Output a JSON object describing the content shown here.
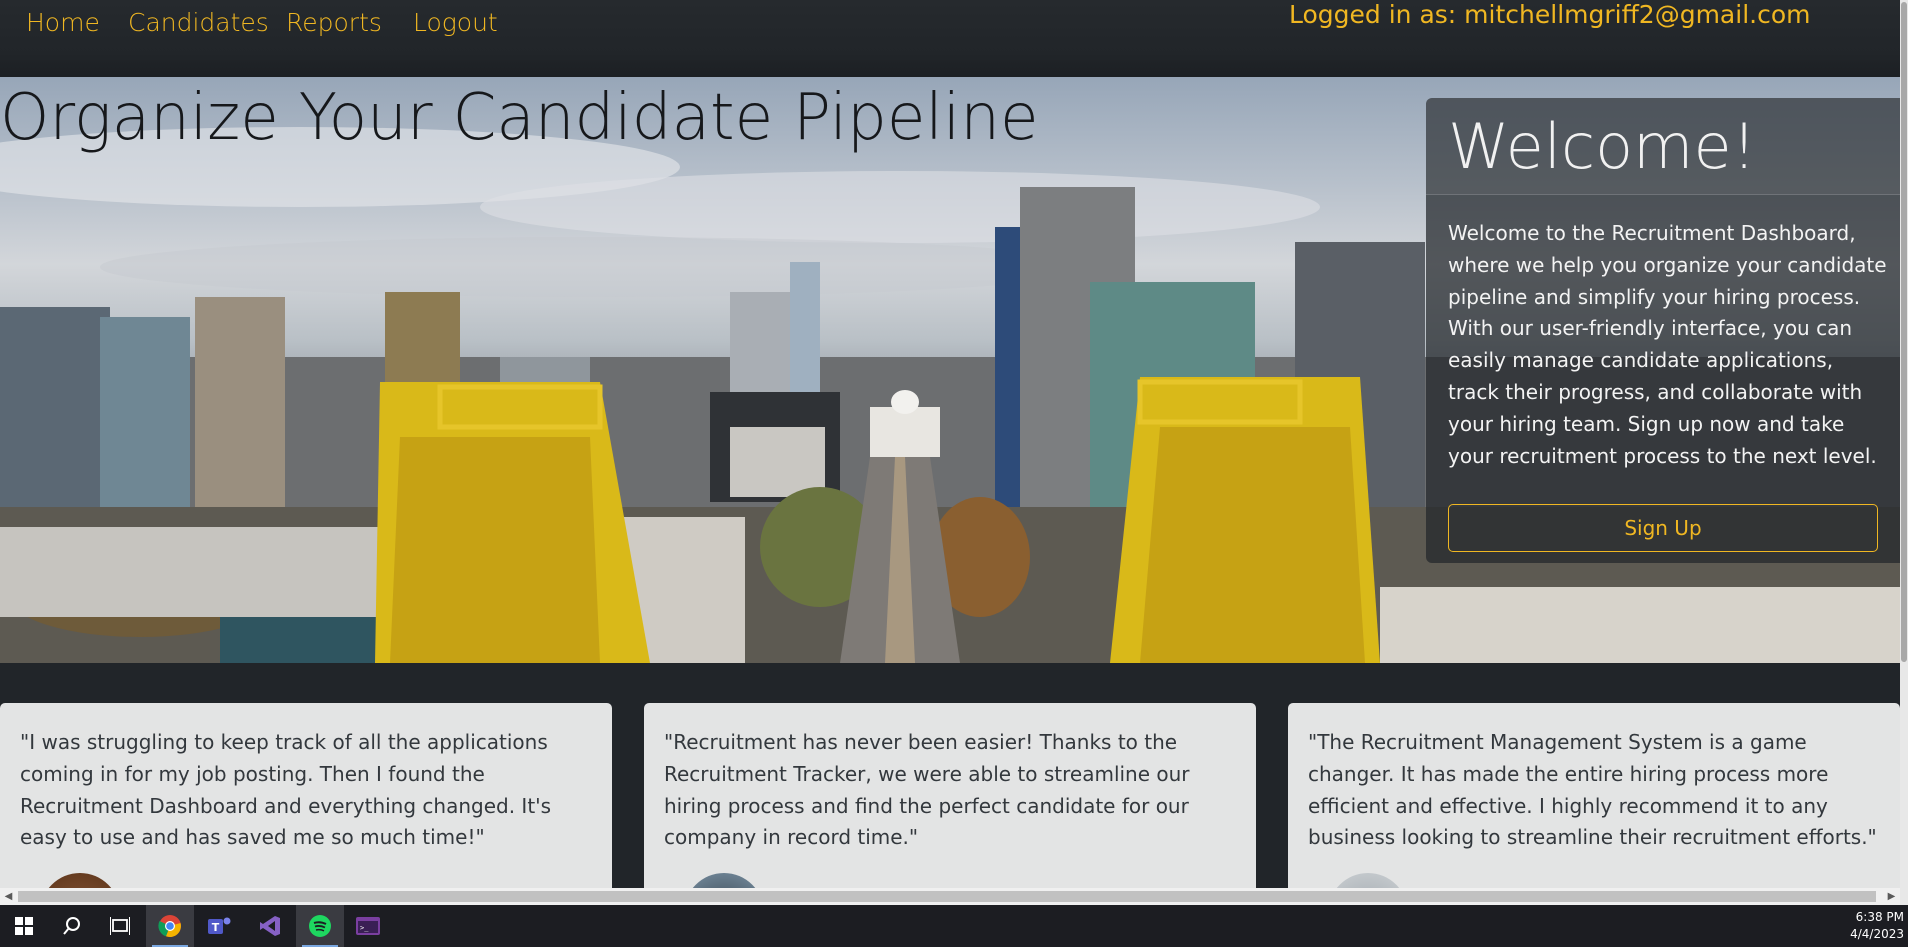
{
  "nav": {
    "links": [
      "Home",
      "Candidates",
      "Reports",
      "Logout"
    ],
    "user_text": "Logged in as: mitchellmgriff2@gmail.com"
  },
  "hero": {
    "title": "Organize Your Candidate Pipeline"
  },
  "welcome": {
    "title": "Welcome!",
    "text": "Welcome to the Recruitment Dashboard, where we help you organize your candidate pipeline and simplify your hiring process. With our user-friendly interface, you can easily manage candidate applications, track their progress, and collaborate with your hiring team. Sign up now and take your recruitment process to the next level.",
    "button": "Sign Up"
  },
  "testimonials": [
    "\"I was struggling to keep track of all the applications coming in for my job posting. Then I found the Recruitment Dashboard and everything changed. It's easy to use and has saved me so much time!\"",
    "\"Recruitment has never been easier! Thanks to the Recruitment Tracker, we were able to streamline our hiring process and find the perfect candidate for our company in record time.\"",
    "\"The Recruitment Management System is a game changer. It has made the entire hiring process more efficient and effective. I highly recommend it to any business looking to streamline their recruitment efforts.\""
  ],
  "taskbar": {
    "icons": [
      "windows-start-icon",
      "search-icon",
      "task-view-icon",
      "chrome-icon",
      "teams-icon",
      "visual-studio-icon",
      "spotify-icon",
      "terminal-icon"
    ],
    "time": "6:38 PM",
    "date": "4/4/2023"
  },
  "colors": {
    "accent": "#f0b722",
    "navbar": "#212529",
    "card": "#e3e4e4"
  }
}
